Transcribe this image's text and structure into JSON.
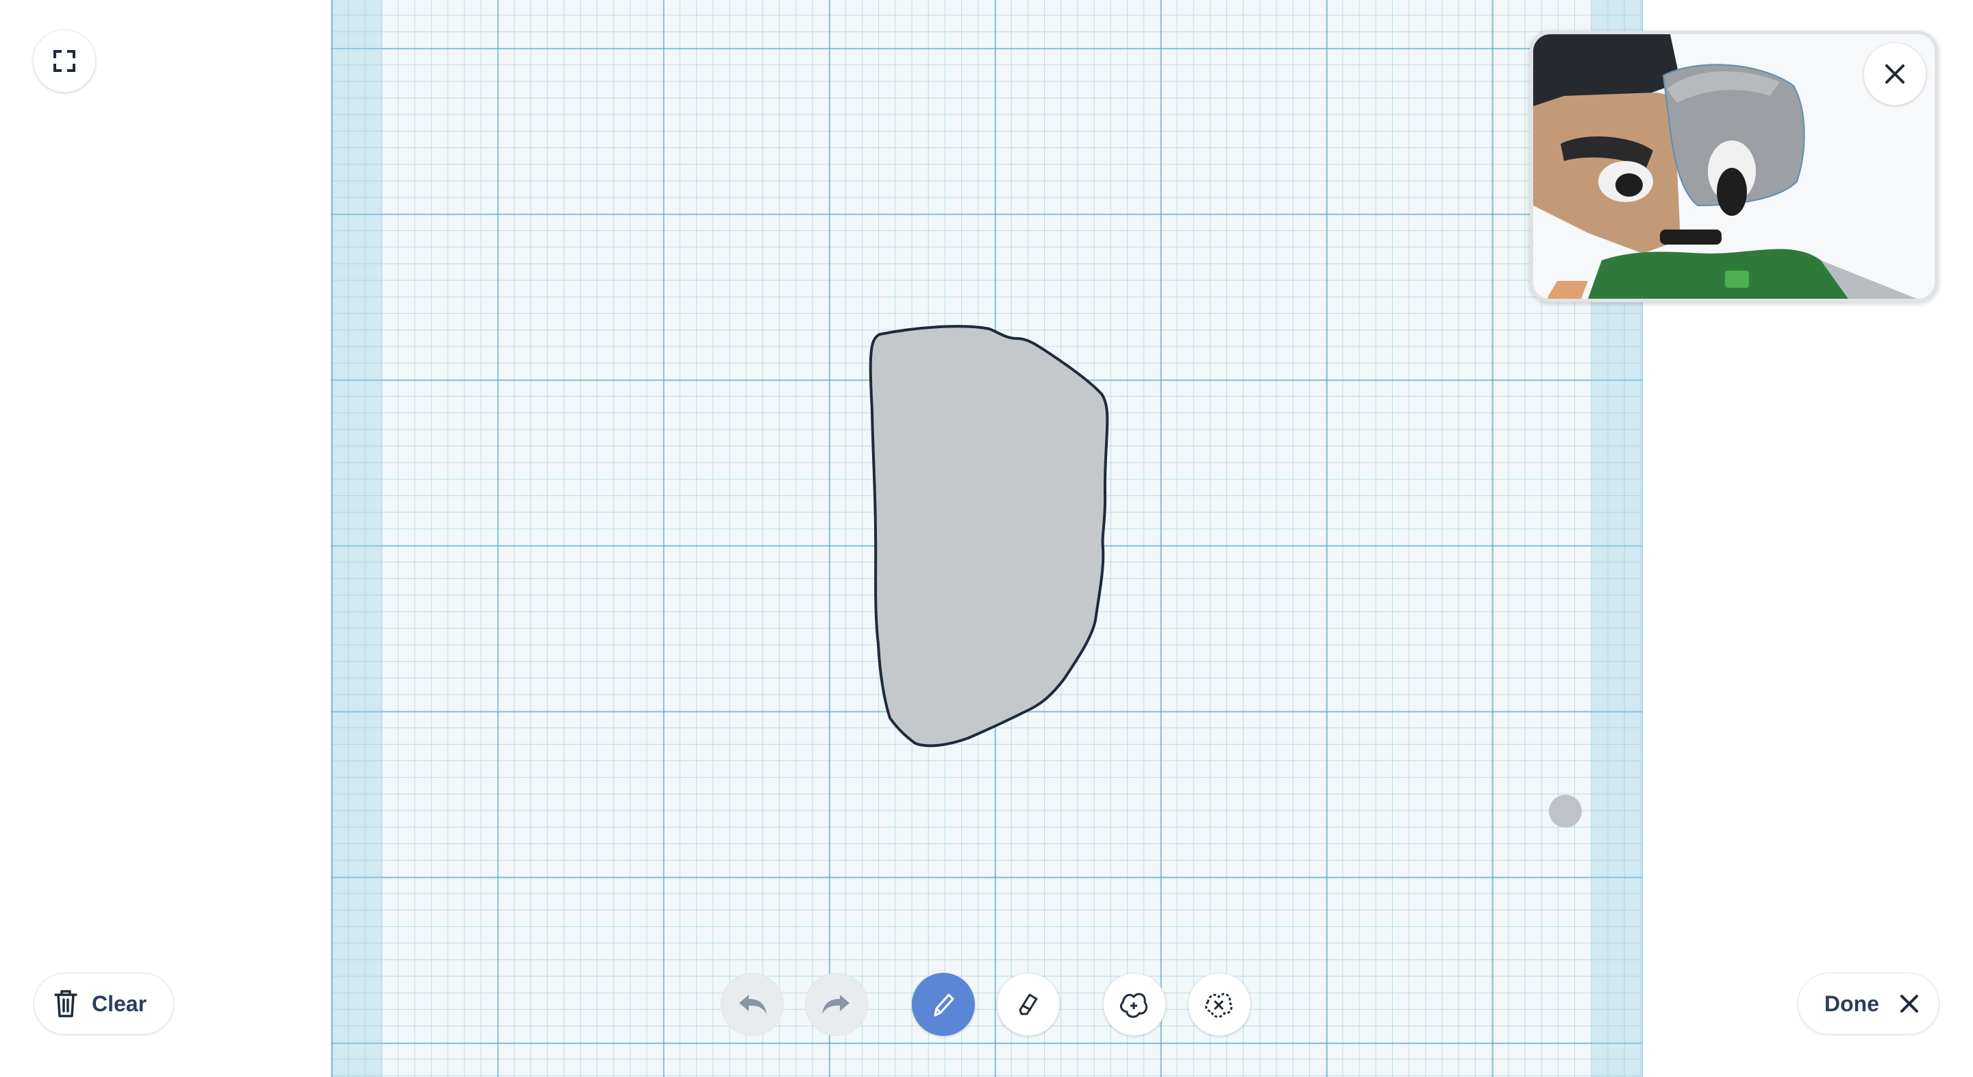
{
  "actions": {
    "clear_label": "Clear",
    "done_label": "Done"
  },
  "toolbar": {
    "tools": [
      {
        "name": "undo",
        "icon": "undo-icon",
        "enabled": false
      },
      {
        "name": "redo",
        "icon": "redo-icon",
        "enabled": false
      },
      {
        "name": "pencil",
        "icon": "pencil-icon",
        "active": true
      },
      {
        "name": "eraser",
        "icon": "eraser-icon",
        "active": false
      },
      {
        "name": "shape-add",
        "icon": "shape-add-icon",
        "active": false
      },
      {
        "name": "shape-subtract",
        "icon": "shape-subtract-icon",
        "active": false
      }
    ]
  },
  "icons": {
    "fullscreen": "fullscreen-icon",
    "close": "close-icon",
    "trash": "trash-icon"
  },
  "colors": {
    "accent": "#5b86d6",
    "grid_background": "#f2f7f9",
    "shape_fill": "#c4c8cb",
    "shape_stroke": "#1f2a3a",
    "text": "#2c3e57"
  }
}
